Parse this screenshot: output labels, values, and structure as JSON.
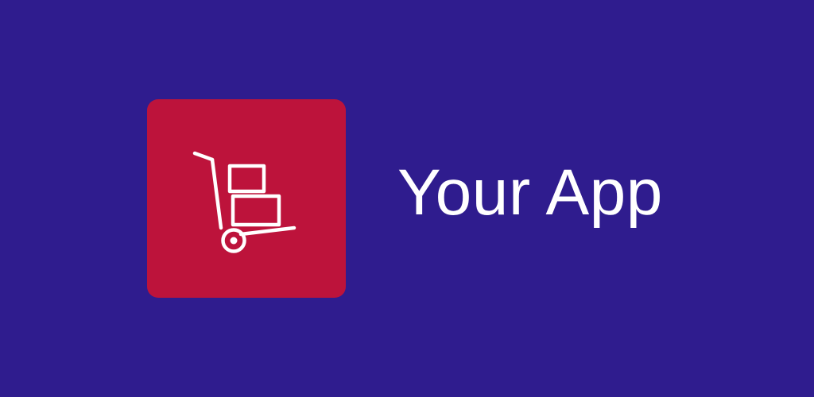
{
  "banner": {
    "app_name": "Your App",
    "icon": "hand-truck-icon",
    "colors": {
      "background": "#2f1c8e",
      "tile": "#bd133b",
      "foreground": "#ffffff"
    }
  }
}
